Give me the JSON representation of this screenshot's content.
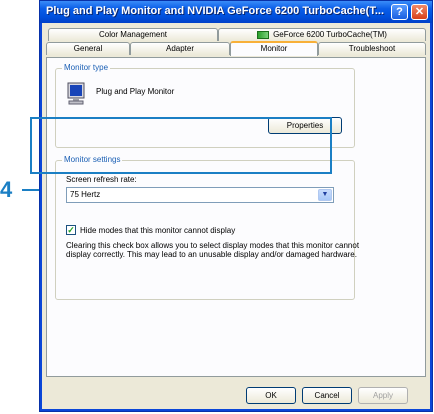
{
  "window": {
    "title": "Plug and Play Monitor and NVIDIA GeForce 6200 TurboCache(T...",
    "help_glyph": "?",
    "close_glyph": "✕"
  },
  "tabs": {
    "row1": [
      {
        "label": "Color Management"
      },
      {
        "label": "GeForce 6200 TurboCache(TM)",
        "icon": "nvidia-icon"
      }
    ],
    "row2": [
      {
        "label": "General"
      },
      {
        "label": "Adapter"
      },
      {
        "label": "Monitor",
        "active": true
      },
      {
        "label": "Troubleshoot"
      }
    ]
  },
  "monitor_type": {
    "group_label": "Monitor type",
    "icon": "monitor-icon",
    "name": "Plug and Play Monitor",
    "properties_button": "Properties"
  },
  "monitor_settings": {
    "group_label": "Monitor settings",
    "refresh_label": "Screen refresh rate:",
    "refresh_value": "75 Hertz",
    "hide_modes_checked": true,
    "hide_modes_label": "Hide modes that this monitor cannot display",
    "description": "Clearing this check box allows you to select display modes that this monitor cannot display correctly. This may lead to an unusable display and/or damaged hardware."
  },
  "buttons": {
    "ok": "OK",
    "cancel": "Cancel",
    "apply": "Apply"
  },
  "callout": {
    "number": "4",
    "color": "#1b7fc4"
  }
}
